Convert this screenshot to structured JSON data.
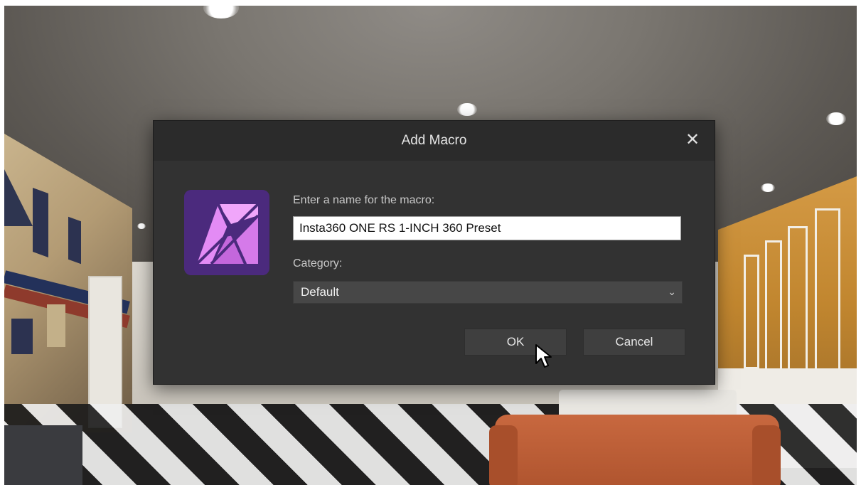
{
  "dialog": {
    "title": "Add Macro",
    "close_label": "✕",
    "name_label": "Enter a name for the macro:",
    "name_value": "Insta360 ONE RS 1-INCH 360 Preset",
    "category_label": "Category:",
    "category_value": "Default",
    "ok_label": "OK",
    "cancel_label": "Cancel"
  },
  "icons": {
    "app": "affinity-photo-icon",
    "close": "close-icon",
    "dropdown": "chevron-down-icon",
    "cursor": "mouse-pointer-icon"
  },
  "colors": {
    "dialog_bg": "#323232",
    "title_bar_bg": "#2b2b2b",
    "icon_bg": "#4a2a7a",
    "icon_fg": "#e38bf5"
  }
}
